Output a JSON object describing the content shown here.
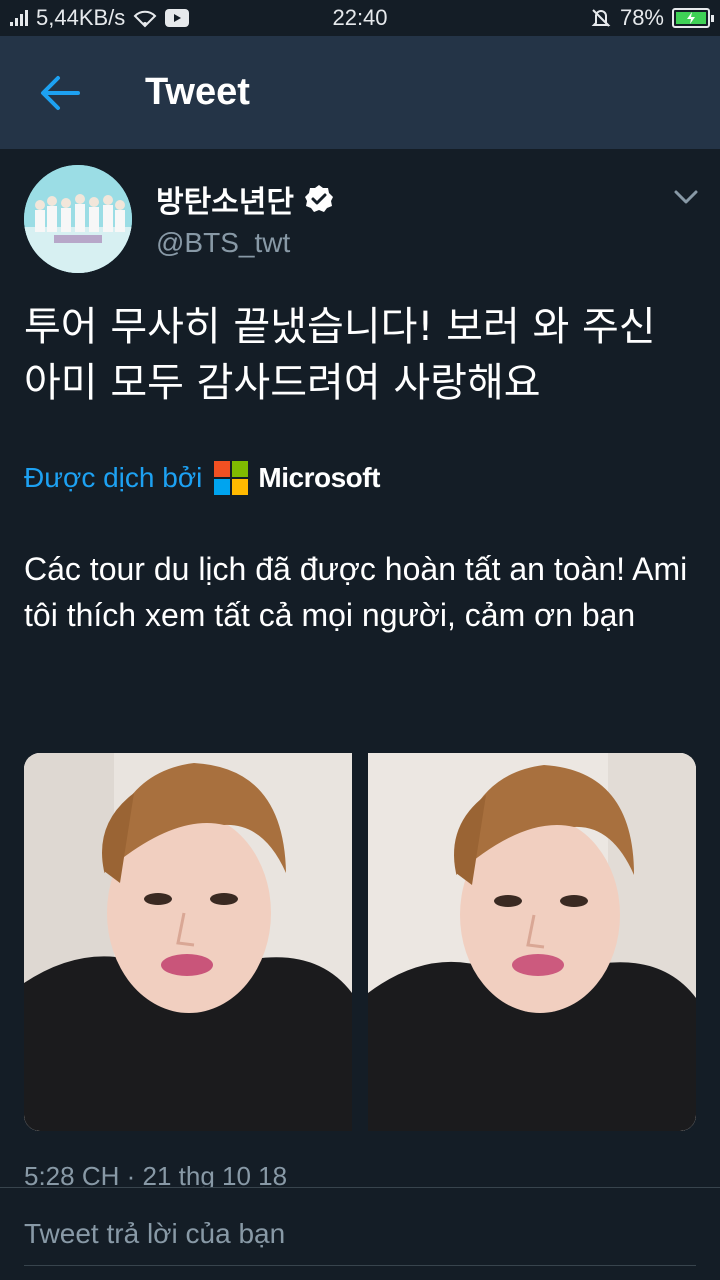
{
  "status_bar": {
    "network_speed": "5,44KB/s",
    "time": "22:40",
    "battery_percent": "78%",
    "battery_level": 0.78
  },
  "header": {
    "title": "Tweet"
  },
  "tweet": {
    "display_name": "방탄소년단",
    "handle": "@BTS_twt",
    "text": "투어 무사히 끝냈습니다! 보러 와 주신 아미 모두 감사드려여 사랑해요",
    "translated_by_label": "Được dịch bởi",
    "translator_name": "Microsoft",
    "translation": "Các tour du lịch đã được hoàn tất an toàn! Ami tôi thích xem tất cả mọi người, cảm ơn bạn",
    "timestamp": "5:28 CH · 21 thg 10 18"
  },
  "reply": {
    "placeholder": "Tweet trả lời của bạn"
  },
  "colors": {
    "background": "#141d26",
    "header": "#243447",
    "accent": "#1da1f2",
    "secondary_text": "#8899a6"
  }
}
